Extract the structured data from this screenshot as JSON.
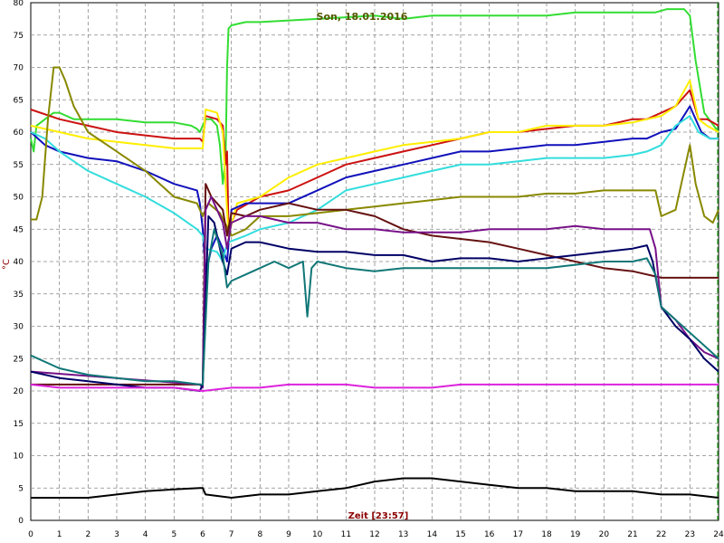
{
  "chart_data": {
    "type": "line",
    "title": "Son, 18.01.2016",
    "xlabel": "Zeit [23:57]",
    "ylabel": "°C",
    "xlim": [
      0,
      24
    ],
    "ylim": [
      0,
      80
    ],
    "xticks": [
      "0",
      "1",
      "2",
      "3",
      "4",
      "5",
      "6",
      "7",
      "8",
      "9",
      "10",
      "11",
      "12",
      "13",
      "14",
      "15",
      "16",
      "17",
      "18",
      "19",
      "20",
      "21",
      "22",
      "23",
      "24"
    ],
    "yticks": [
      "0",
      "5",
      "10",
      "15",
      "20",
      "25",
      "30",
      "35",
      "40",
      "45",
      "50",
      "55",
      "60",
      "65",
      "70",
      "75",
      "80"
    ],
    "grid": true,
    "series": [
      {
        "color": "#33dd33",
        "x": [
          0,
          0.1,
          0.2,
          0.5,
          0.8,
          1,
          1.5,
          2,
          3,
          4,
          5,
          5.6,
          5.8,
          5.9,
          6.1,
          6.3,
          6.5,
          6.6,
          6.7,
          6.8,
          6.85,
          6.9,
          7,
          7.5,
          8,
          10,
          12,
          13,
          14,
          15,
          16,
          17,
          18,
          19,
          20,
          21,
          21.8,
          22.2,
          22.8,
          23,
          23.2,
          23.5,
          24
        ],
        "y": [
          59,
          57,
          61,
          62,
          63,
          63,
          62,
          62,
          62,
          61.5,
          61.5,
          61,
          60.5,
          60,
          62,
          62,
          61,
          58,
          52,
          56,
          70,
          76,
          76.5,
          77,
          77,
          77.5,
          78,
          77.5,
          78,
          78,
          78,
          78,
          78,
          78.5,
          78.5,
          78.5,
          78.5,
          79,
          79,
          78,
          71,
          63,
          60
        ]
      },
      {
        "color": "#cc1111",
        "x": [
          0,
          1,
          2,
          3,
          4,
          5,
          5.9,
          6,
          6.1,
          6.5,
          6.7,
          6.8,
          6.85,
          6.9,
          7.2,
          8,
          9,
          10,
          11,
          12,
          13,
          14,
          15,
          16,
          17,
          18,
          19,
          20,
          21,
          21.5,
          22,
          22.5,
          23,
          23.3,
          23.6,
          24
        ],
        "y": [
          63.5,
          62,
          61,
          60,
          59.5,
          59,
          59,
          58.5,
          62.5,
          62,
          61,
          55,
          57,
          45,
          48,
          50,
          51,
          53,
          55,
          56,
          57,
          58,
          59,
          60,
          60,
          60.5,
          61,
          61,
          62,
          62,
          63,
          64,
          66.5,
          62,
          62,
          61
        ]
      },
      {
        "color": "#ffee00",
        "x": [
          0,
          1,
          2,
          3,
          4,
          5,
          5.9,
          6,
          6.1,
          6.5,
          6.7,
          6.8,
          6.9,
          7.2,
          8,
          9,
          10,
          11,
          12,
          13,
          14,
          15,
          16,
          17,
          18,
          19,
          20,
          21,
          21.5,
          22,
          22.5,
          23,
          23.3,
          23.6,
          24
        ],
        "y": [
          61,
          60,
          59,
          58.5,
          58,
          57.5,
          57.5,
          57.5,
          63.5,
          63,
          60,
          52,
          44,
          49,
          50,
          53,
          55,
          56,
          57,
          58,
          58.5,
          59,
          60,
          60,
          61,
          61,
          61,
          61.5,
          62,
          62.5,
          64,
          68,
          62,
          61,
          60
        ]
      },
      {
        "color": "#1111bb",
        "x": [
          0,
          0.5,
          1,
          2,
          3,
          4,
          5,
          5.8,
          5.9,
          6,
          6.1,
          6.3,
          6.5,
          6.7,
          6.85,
          7,
          7.5,
          8,
          9,
          10,
          11,
          12,
          13,
          14,
          15,
          16,
          17,
          18,
          19,
          20,
          21,
          21.5,
          22,
          22.5,
          23,
          23.4,
          23.7,
          24
        ],
        "y": [
          60,
          58,
          57,
          56,
          55.5,
          54,
          52,
          51,
          49,
          45,
          38,
          42,
          44,
          42,
          40,
          48,
          49,
          49,
          49,
          51,
          53,
          54,
          55,
          56,
          57,
          57,
          57.5,
          58,
          58,
          58.5,
          59,
          59,
          60,
          60.5,
          64,
          60,
          59,
          59
        ]
      },
      {
        "color": "#33dddd",
        "x": [
          0,
          0.5,
          1,
          2,
          3,
          4,
          5,
          5.8,
          6,
          6.1,
          6.5,
          6.7,
          6.8,
          6.9,
          7.5,
          8,
          9,
          10,
          11,
          12,
          13,
          14,
          15,
          16,
          17,
          18,
          19,
          20,
          21,
          21.5,
          22,
          22.5,
          23,
          23.3,
          23.7,
          24
        ],
        "y": [
          60,
          59,
          57,
          54,
          52,
          50,
          47.5,
          45,
          44,
          42,
          41.5,
          40,
          42,
          43,
          44,
          45,
          46,
          48,
          51,
          52,
          53,
          54,
          55,
          55,
          55.5,
          56,
          56,
          56,
          56.5,
          57,
          58,
          61,
          62.5,
          60,
          59,
          59
        ]
      },
      {
        "color": "#888800",
        "x": [
          0,
          0.2,
          0.4,
          0.6,
          0.8,
          1,
          1.2,
          1.5,
          2,
          3,
          4,
          5,
          5.8,
          6,
          6.2,
          6.6,
          7,
          7.5,
          8,
          9,
          10,
          11,
          12,
          13,
          14,
          15,
          16,
          17,
          18,
          19,
          20,
          21,
          21.8,
          22,
          22.5,
          23,
          23.2,
          23.5,
          23.8,
          24
        ],
        "y": [
          46.5,
          46.5,
          50,
          62,
          70,
          70,
          68,
          64,
          60,
          57,
          54,
          50,
          49,
          47,
          49,
          47.5,
          44,
          45,
          47,
          47,
          47.5,
          48,
          48.5,
          49,
          49.5,
          50,
          50,
          50,
          50.5,
          50.5,
          51,
          51,
          51,
          47,
          48,
          58,
          52,
          47,
          46,
          48
        ]
      },
      {
        "color": "#661111",
        "x": [
          0,
          5.9,
          6,
          6.1,
          6.3,
          6.5,
          6.7,
          6.85,
          7,
          7.5,
          8,
          9,
          10,
          11,
          11.5,
          12,
          13,
          14,
          15,
          16,
          17,
          18,
          19,
          20,
          21,
          22,
          24
        ],
        "y": [
          21,
          21,
          21,
          52,
          50,
          49,
          48,
          44,
          47.5,
          47,
          48,
          49,
          48,
          48,
          47.5,
          47,
          45,
          44,
          43.5,
          43,
          42,
          41,
          40,
          39,
          38.5,
          37.5,
          37.5
        ]
      },
      {
        "color": "#771188",
        "x": [
          0,
          5.9,
          6,
          6.1,
          6.3,
          6.5,
          6.7,
          6.85,
          7,
          7.5,
          8,
          9,
          10,
          11,
          12,
          13,
          14,
          15,
          16,
          17,
          18,
          19,
          20,
          21,
          21.6,
          21.8,
          22,
          22.5,
          23,
          23.5,
          24
        ],
        "y": [
          23,
          21,
          20.5,
          48,
          50,
          48,
          46,
          42,
          46,
          47,
          47,
          46,
          46,
          45,
          45,
          44.5,
          44.5,
          44.5,
          45,
          45,
          45,
          45.5,
          45,
          45,
          45,
          42,
          33,
          31,
          28,
          26,
          25
        ]
      },
      {
        "color": "#000066",
        "x": [
          0,
          1,
          2,
          3,
          4,
          5,
          5.9,
          6,
          6.2,
          6.4,
          6.7,
          6.85,
          7,
          7.5,
          8,
          9,
          10,
          11,
          12,
          13,
          14,
          15,
          16,
          17,
          18,
          19,
          20,
          21,
          21.5,
          21.7,
          22,
          22.5,
          23,
          23.5,
          24
        ],
        "y": [
          23,
          22,
          21.5,
          21,
          20.5,
          20.5,
          20,
          21,
          47,
          46,
          40,
          38,
          42,
          43,
          43,
          42,
          41.5,
          41.5,
          41,
          41,
          40,
          40.5,
          40.5,
          40,
          40.5,
          41,
          41.5,
          42,
          42.5,
          40,
          33,
          30,
          28,
          25,
          23
        ]
      },
      {
        "color": "#117777",
        "x": [
          0,
          1,
          2,
          3,
          4,
          5,
          5.9,
          6,
          6.2,
          6.4,
          6.7,
          6.85,
          7,
          7.5,
          8,
          8.5,
          9,
          9.5,
          9.65,
          9.8,
          10,
          11,
          12,
          13,
          14,
          15,
          16,
          17,
          18,
          19,
          20,
          21,
          21.5,
          21.8,
          22,
          22.5,
          23,
          23.5,
          24
        ],
        "y": [
          25.5,
          23.5,
          22.5,
          22,
          21.5,
          21.5,
          21,
          21,
          40,
          45,
          41,
          36,
          37,
          38,
          39,
          40,
          39,
          40,
          31.5,
          39,
          40,
          39,
          38.5,
          39,
          39,
          39,
          39,
          39,
          39,
          39.5,
          40,
          40,
          40.5,
          38,
          33,
          31,
          29,
          27,
          25
        ]
      },
      {
        "color": "#dd22dd",
        "x": [
          0,
          1,
          2,
          3,
          4,
          5,
          6,
          7,
          8,
          9,
          10,
          11,
          12,
          13,
          14,
          15,
          16,
          17,
          18,
          19,
          20,
          21,
          22,
          23,
          24
        ],
        "y": [
          21,
          20.5,
          20.5,
          20.5,
          20.5,
          20.5,
          20,
          20.5,
          20.5,
          21,
          21,
          21,
          20.5,
          20.5,
          20.5,
          21,
          21,
          21,
          21,
          21,
          21,
          21,
          21,
          21,
          21
        ]
      },
      {
        "color": "#000000",
        "x": [
          0,
          1,
          2,
          3,
          4,
          5,
          5.9,
          6,
          6.1,
          7,
          8,
          9,
          10,
          11,
          12,
          13,
          14,
          15,
          16,
          17,
          18,
          19,
          20,
          21,
          22,
          23,
          24
        ],
        "y": [
          3.5,
          3.5,
          3.5,
          4,
          4.5,
          4.8,
          5,
          5,
          4,
          3.5,
          4,
          4,
          4.5,
          5,
          6,
          6.5,
          6.5,
          6,
          5.5,
          5,
          5,
          4.5,
          4.5,
          4.5,
          4,
          4,
          3.5
        ]
      }
    ]
  }
}
